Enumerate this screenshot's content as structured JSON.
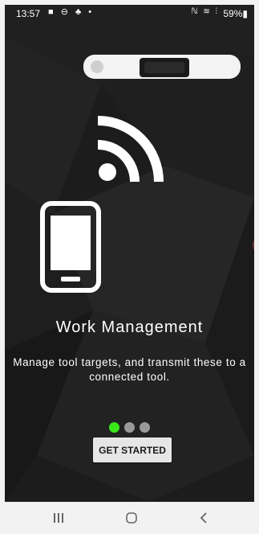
{
  "status_bar": {
    "time": "13:57",
    "left_icons": "■ ⊖ ♣ •",
    "right_icons": "ℕ ≋ ⫶",
    "battery": "59%▮"
  },
  "onboarding": {
    "title": "Work Management",
    "description": "Manage tool targets, and transmit these to a connected tool.",
    "page_indicator": {
      "active_index": 0,
      "total": 3,
      "active_color": "#39e61a",
      "inactive_color": "#9a9a9a"
    },
    "button_label": "GET STARTED"
  },
  "navbar": {
    "recents_icon": "recents-icon",
    "home_icon": "home-icon",
    "back_icon": "back-icon"
  },
  "colors": {
    "background": "#1a1a1a",
    "text": "#ffffff",
    "button_bg": "#e6e6e6"
  }
}
